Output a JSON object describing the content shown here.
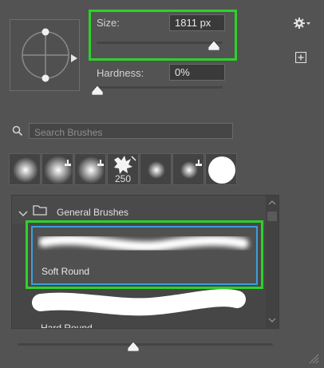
{
  "size": {
    "label": "Size:",
    "value": "1811 px"
  },
  "hardness": {
    "label": "Hardness:",
    "value": "0%"
  },
  "search": {
    "placeholder": "Search Brushes"
  },
  "recent_brushes": [
    {
      "name": "soft-round-recent",
      "badge": false
    },
    {
      "name": "soft-round-recent",
      "badge": true
    },
    {
      "name": "soft-round-recent",
      "badge": true
    },
    {
      "name": "splatter-brush",
      "badge": true,
      "count": "250"
    },
    {
      "name": "soft-round-recent",
      "badge": false
    },
    {
      "name": "soft-round-recent",
      "badge": true
    },
    {
      "name": "hard-round-recent",
      "badge": false
    }
  ],
  "brush_group": {
    "name": "General Brushes"
  },
  "brushes": {
    "soft_round": "Soft Round",
    "hard_round": "Hard Round"
  },
  "colors": {
    "highlight": "#2ed12a",
    "selection": "#3aa0db",
    "panel_bg": "#535353"
  },
  "icons": {
    "settings": "gear-icon",
    "new_preset": "plus-square-icon",
    "search": "search-icon",
    "folder": "folder-icon",
    "collapse": "chevron-down-icon",
    "resize": "resize-grip-icon"
  }
}
